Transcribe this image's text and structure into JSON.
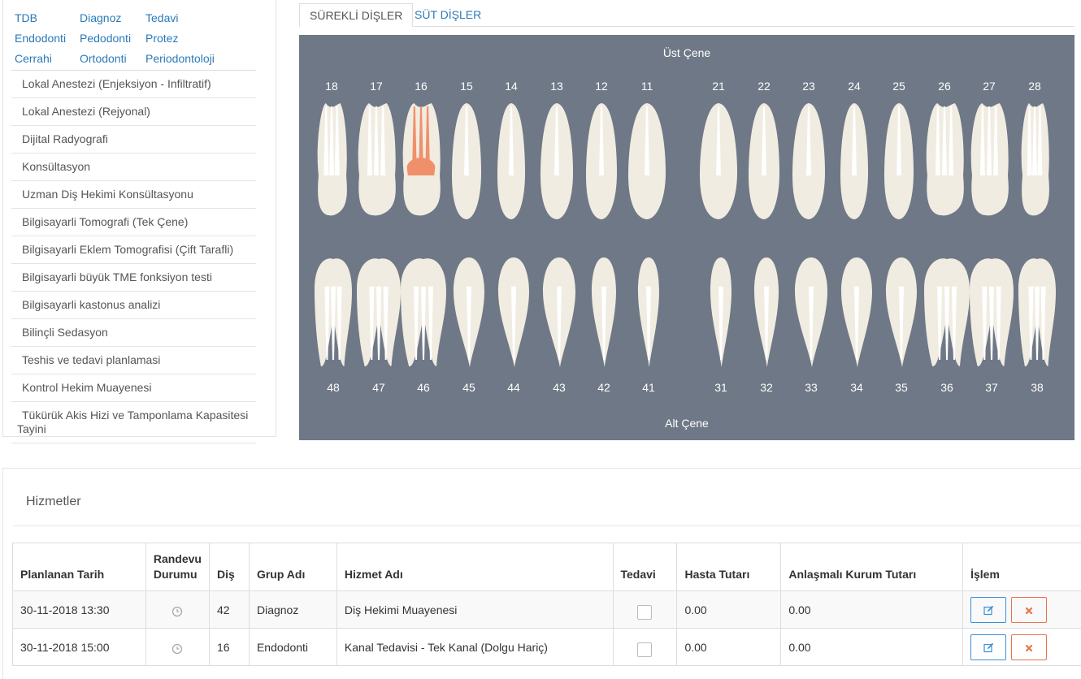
{
  "categories": [
    "TDB",
    "Diagnoz",
    "Tedavi",
    "Endodonti",
    "Pedodonti",
    "Protez",
    "Cerrahi",
    "Ortodonti",
    "Periodontoloji"
  ],
  "services": [
    "Lokal Anestezi (Enjeksiyon - Infiltratif)",
    "Lokal Anestezi (Rejyonal)",
    "Dijital Radyografi",
    "Konsültasyon",
    "Uzman Diş Hekimi Konsültasyonu",
    "Bilgisayarli Tomografi (Tek Çene)",
    "Bilgisayarli Eklem Tomografisi (Çift Tarafli)",
    "Bilgisayarli büyük TME fonksiyon testi",
    "Bilgisayarli kastonus analizi",
    "Bilinçli Sedasyon",
    "Teshis ve tedavi planlamasi",
    "Kontrol Hekim Muayenesi",
    "Tükürük Akis Hizi ve Tamponlama Kapasitesi Tayini"
  ],
  "tabs": [
    {
      "label": "SÜREKLİ DİŞLER",
      "active": true
    },
    {
      "label": "SÜT DİŞLER",
      "active": false
    }
  ],
  "chart": {
    "upper_label": "Üst Çene",
    "lower_label": "Alt Çene",
    "upper_teeth": [
      "18",
      "17",
      "16",
      "15",
      "14",
      "13",
      "12",
      "11",
      "21",
      "22",
      "23",
      "24",
      "25",
      "26",
      "27",
      "28"
    ],
    "lower_teeth": [
      "48",
      "47",
      "46",
      "45",
      "44",
      "43",
      "42",
      "41",
      "31",
      "32",
      "33",
      "34",
      "35",
      "36",
      "37",
      "38"
    ],
    "highlighted_tooth": "16",
    "colors": {
      "background": "#6f7886",
      "tooth": "#f1ece1",
      "root": "#ffffff",
      "highlight": "#f0906b"
    }
  },
  "hizmetler": {
    "title": "Hizmetler",
    "columns": [
      "Planlanan Tarih",
      "Randevu Durumu",
      "Diş",
      "Grup Adı",
      "Hizmet Adı",
      "Tedavi",
      "Hasta Tutarı",
      "Anlaşmalı Kurum Tutarı",
      "İşlem"
    ],
    "rows": [
      {
        "date": "30-11-2018 13:30",
        "status_icon": "clock-icon",
        "tooth": "42",
        "group": "Diagnoz",
        "service": "Diş Hekimi Muayenesi",
        "treated": false,
        "patient_amount": "0.00",
        "institution_amount": "0.00"
      },
      {
        "date": "30-11-2018 15:00",
        "status_icon": "clock-icon",
        "tooth": "16",
        "group": "Endodonti",
        "service": "Kanal Tedavisi - Tek Kanal (Dolgu Hariç)",
        "treated": false,
        "patient_amount": "0.00",
        "institution_amount": "0.00"
      }
    ]
  }
}
